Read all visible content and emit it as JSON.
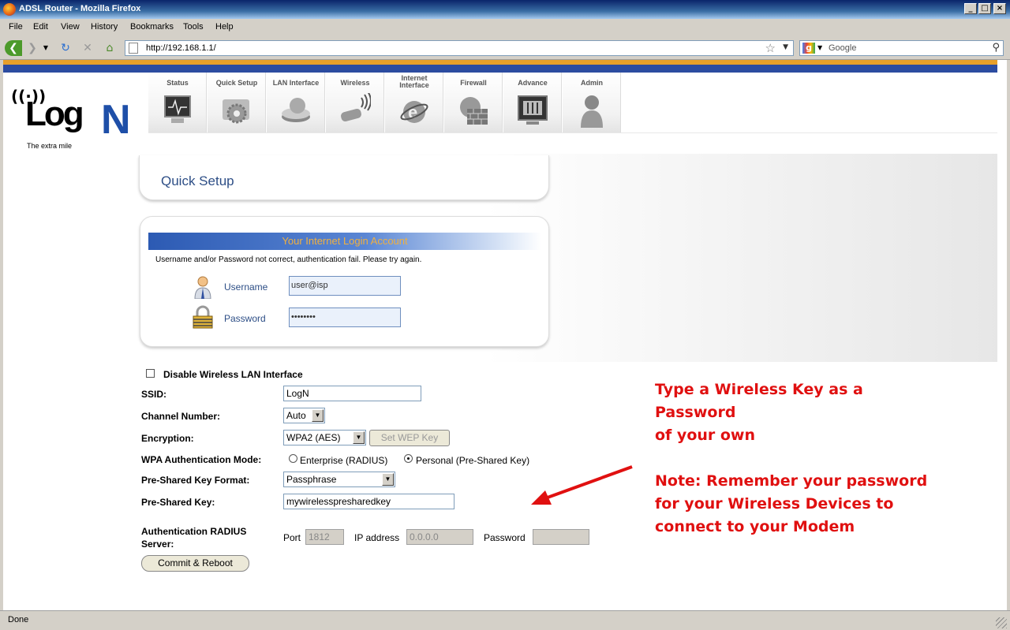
{
  "window": {
    "title": "ADSL Router - Mozilla Firefox",
    "min": "_",
    "max": "□",
    "close": "×"
  },
  "menu": [
    "File",
    "Edit",
    "View",
    "History",
    "Bookmarks",
    "Tools",
    "Help"
  ],
  "toolbar": {
    "url": "http://192.168.1.1/",
    "search_placeholder": "Google",
    "search_engine_letter": "g"
  },
  "logo": {
    "waves": "((·))",
    "brand": "Log",
    "brand_n": "N",
    "tagline": "The extra mile"
  },
  "nav": [
    {
      "label": "Status",
      "icon": "monitor-icon"
    },
    {
      "label": "Quick Setup",
      "icon": "gear-icon"
    },
    {
      "label": "LAN Interface",
      "icon": "hard-drive-icon"
    },
    {
      "label": "Wireless",
      "icon": "wireless-adapter-icon"
    },
    {
      "label": "Internet\nInterface",
      "icon": "internet-explorer-icon"
    },
    {
      "label": "Firewall",
      "icon": "firewall-icon"
    },
    {
      "label": "Advance",
      "icon": "control-panel-icon"
    },
    {
      "label": "Admin",
      "icon": "user-icon"
    }
  ],
  "quick_setup": {
    "title": "Quick Setup"
  },
  "login": {
    "header": "Your Internet Login Account",
    "error": "Username and/or Password not correct, authentication fail. Please try again.",
    "username_label": "Username",
    "username_value": "user@isp",
    "password_label": "Password",
    "password_value": "••••••••"
  },
  "wireless": {
    "disable_label": "Disable Wireless LAN Interface",
    "ssid_label": "SSID:",
    "ssid_value": "LogN",
    "channel_label": "Channel Number:",
    "channel_value": "Auto",
    "encryption_label": "Encryption:",
    "encryption_value": "WPA2 (AES)",
    "set_wep_label": "Set WEP Key",
    "auth_mode_label": "WPA Authentication Mode:",
    "auth_enterprise": "Enterprise (RADIUS)",
    "auth_personal": "Personal (Pre-Shared Key)",
    "psk_format_label": "Pre-Shared Key Format:",
    "psk_format_value": "Passphrase",
    "psk_label": "Pre-Shared Key:",
    "psk_value": "mywirelesspresharedkey",
    "radius_label_1": "Authentication RADIUS",
    "radius_label_2": "Server:",
    "port_label": "Port",
    "port_value": "1812",
    "ip_label": "IP address",
    "ip_value": "0.0.0.0",
    "radius_password_label": "Password",
    "radius_password_value": "",
    "commit_label": "Commit & Reboot"
  },
  "annotation": {
    "line1": "Type a Wireless Key as a Password",
    "line2": "of your own",
    "line3": "Note: Remember your password",
    "line4": "for your Wireless Devices to",
    "line5": "connect to your Modem",
    "color": "#e01010"
  },
  "status": {
    "text": "Done"
  }
}
